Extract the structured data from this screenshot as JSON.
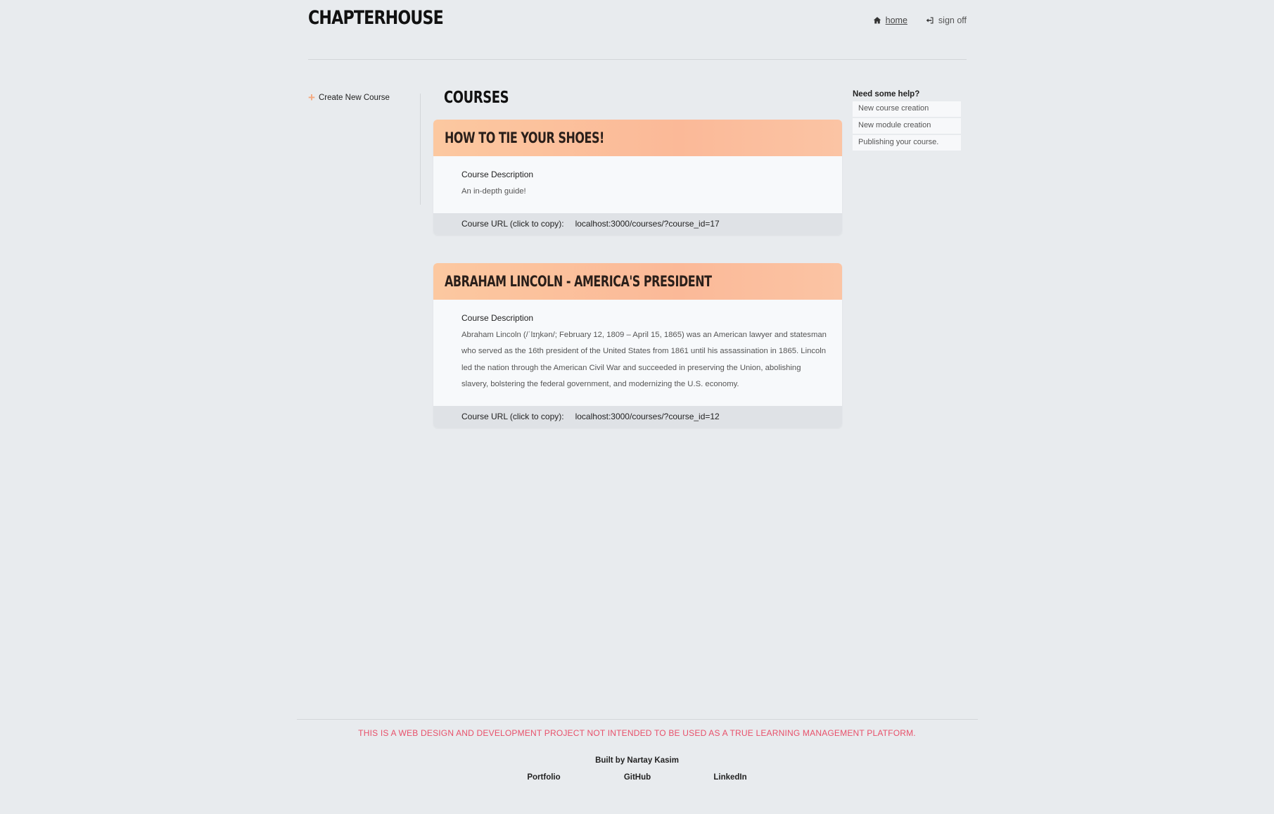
{
  "app": {
    "title": "CHAPTERHOUSE"
  },
  "nav": {
    "home_label": "home",
    "signoff_label": "sign off"
  },
  "sidebar": {
    "create_label": "Create New Course"
  },
  "main": {
    "title": "COURSES",
    "description_label": "Course Description",
    "url_label": "Course URL (click to copy):",
    "courses": [
      {
        "title": "How to tie your shoes!",
        "description": "An in-depth guide!",
        "url": "localhost:3000/courses/?course_id=17"
      },
      {
        "title": "Abraham Lincoln - America's President",
        "description": "Abraham Lincoln (/ˈlɪŋkən/; February 12, 1809 – April 15, 1865) was an American lawyer and statesman who served as the 16th president of the United States from 1861 until his assassination in 1865. Lincoln led the nation through the American Civil War and succeeded in preserving the Union, abolishing slavery, bolstering the federal government, and modernizing the U.S. economy.",
        "url": "localhost:3000/courses/?course_id=12"
      }
    ]
  },
  "help": {
    "title": "Need some help?",
    "items": [
      "New course creation",
      "New module creation",
      "Publishing your course."
    ]
  },
  "footer": {
    "disclaimer": "THIS IS A WEB DESIGN AND DEVELOPMENT PROJECT NOT INTENDED TO BE USED AS A TRUE LEARNING MANAGEMENT PLATFORM.",
    "built_by": "Built by Nartay Kasim",
    "links": [
      "Portfolio",
      "GitHub",
      "LinkedIn"
    ]
  },
  "colors": {
    "background": "#e8ebee",
    "card_header": "#fbbf9c",
    "accent": "#f4a97f",
    "disclaimer": "#e8506a"
  }
}
